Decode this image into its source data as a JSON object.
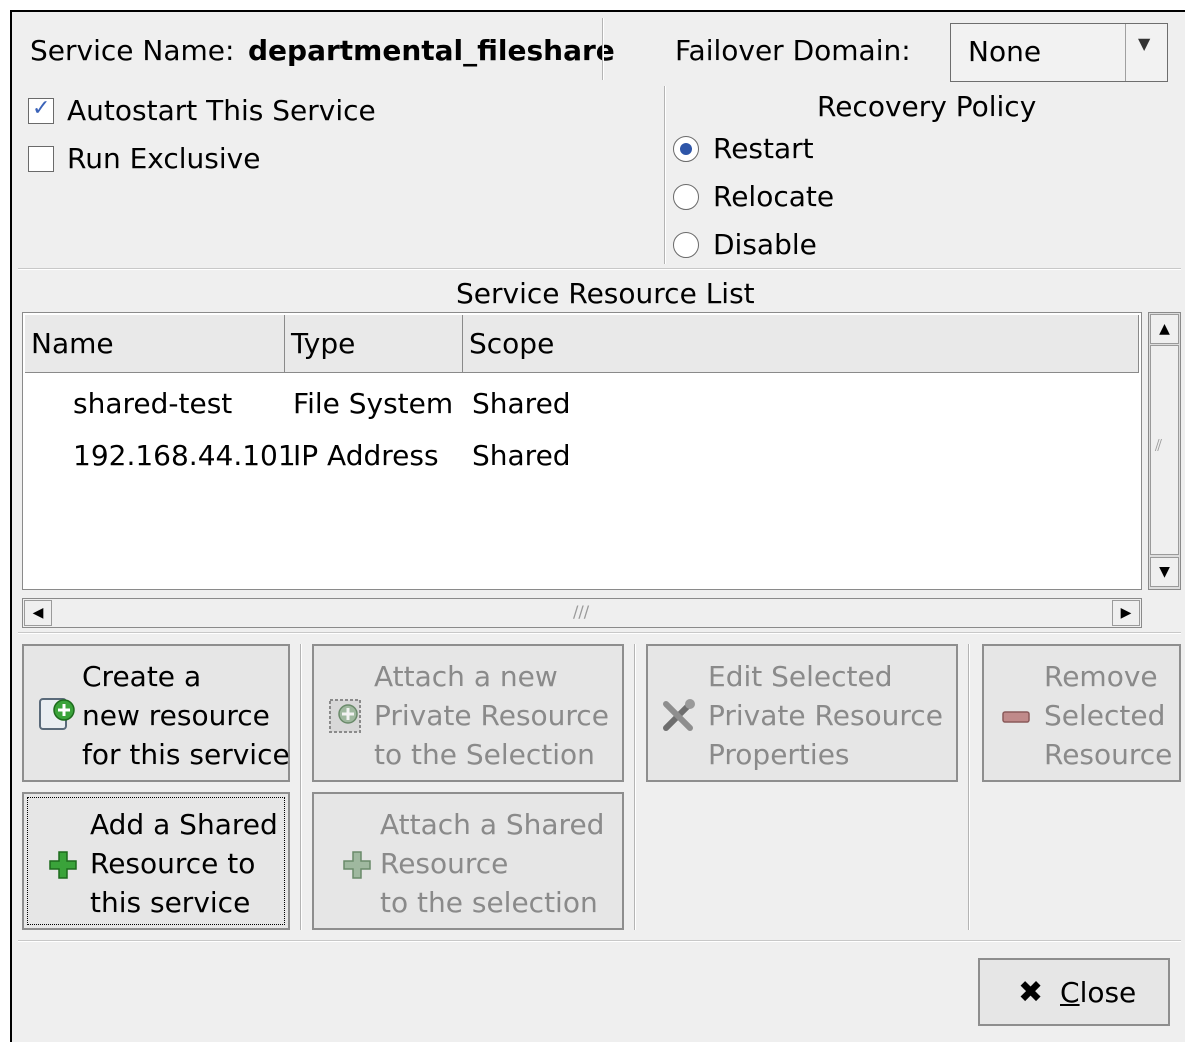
{
  "service": {
    "name_label": "Service Name:",
    "name_value": "departmental_fileshare",
    "failover_label": "Failover Domain:",
    "failover_value": "None"
  },
  "options": {
    "autostart_label": "Autostart This Service",
    "autostart_checked": true,
    "exclusive_label": "Run Exclusive",
    "exclusive_checked": false
  },
  "recovery": {
    "title": "Recovery Policy",
    "options": [
      "Restart",
      "Relocate",
      "Disable"
    ],
    "selected": "Restart"
  },
  "resources": {
    "title": "Service Resource List",
    "columns": [
      "Name",
      "Type",
      "Scope"
    ],
    "rows": [
      {
        "name": "shared-test",
        "type": "File System",
        "scope": "Shared"
      },
      {
        "name": "192.168.44.101",
        "type": "IP Address",
        "scope": "Shared"
      }
    ]
  },
  "actions": {
    "create": {
      "line1": "Create a",
      "line2": "new resource",
      "line3": "for this service"
    },
    "attach_private": {
      "line1": "Attach a new",
      "line2": "Private Resource",
      "line3": "to the Selection"
    },
    "edit": {
      "line1": "Edit Selected",
      "line2": "Private Resource",
      "line3": "Properties"
    },
    "remove": {
      "line1": "Remove",
      "line2": "Selected",
      "line3": "Resource"
    },
    "add_shared": {
      "line1": "Add a Shared",
      "line2": "Resource to",
      "line3": "this service"
    },
    "attach_shared": {
      "line1": "Attach a Shared",
      "line2": "Resource",
      "line3": "to the selection"
    }
  },
  "close": {
    "label_mnemonic": "C",
    "label_rest": "lose"
  },
  "icons": {
    "dropdown": "chevron-down-icon",
    "close": "x-icon",
    "create": "new-resource-icon",
    "add": "green-plus-icon",
    "edit": "tools-icon",
    "remove": "remove-icon"
  }
}
